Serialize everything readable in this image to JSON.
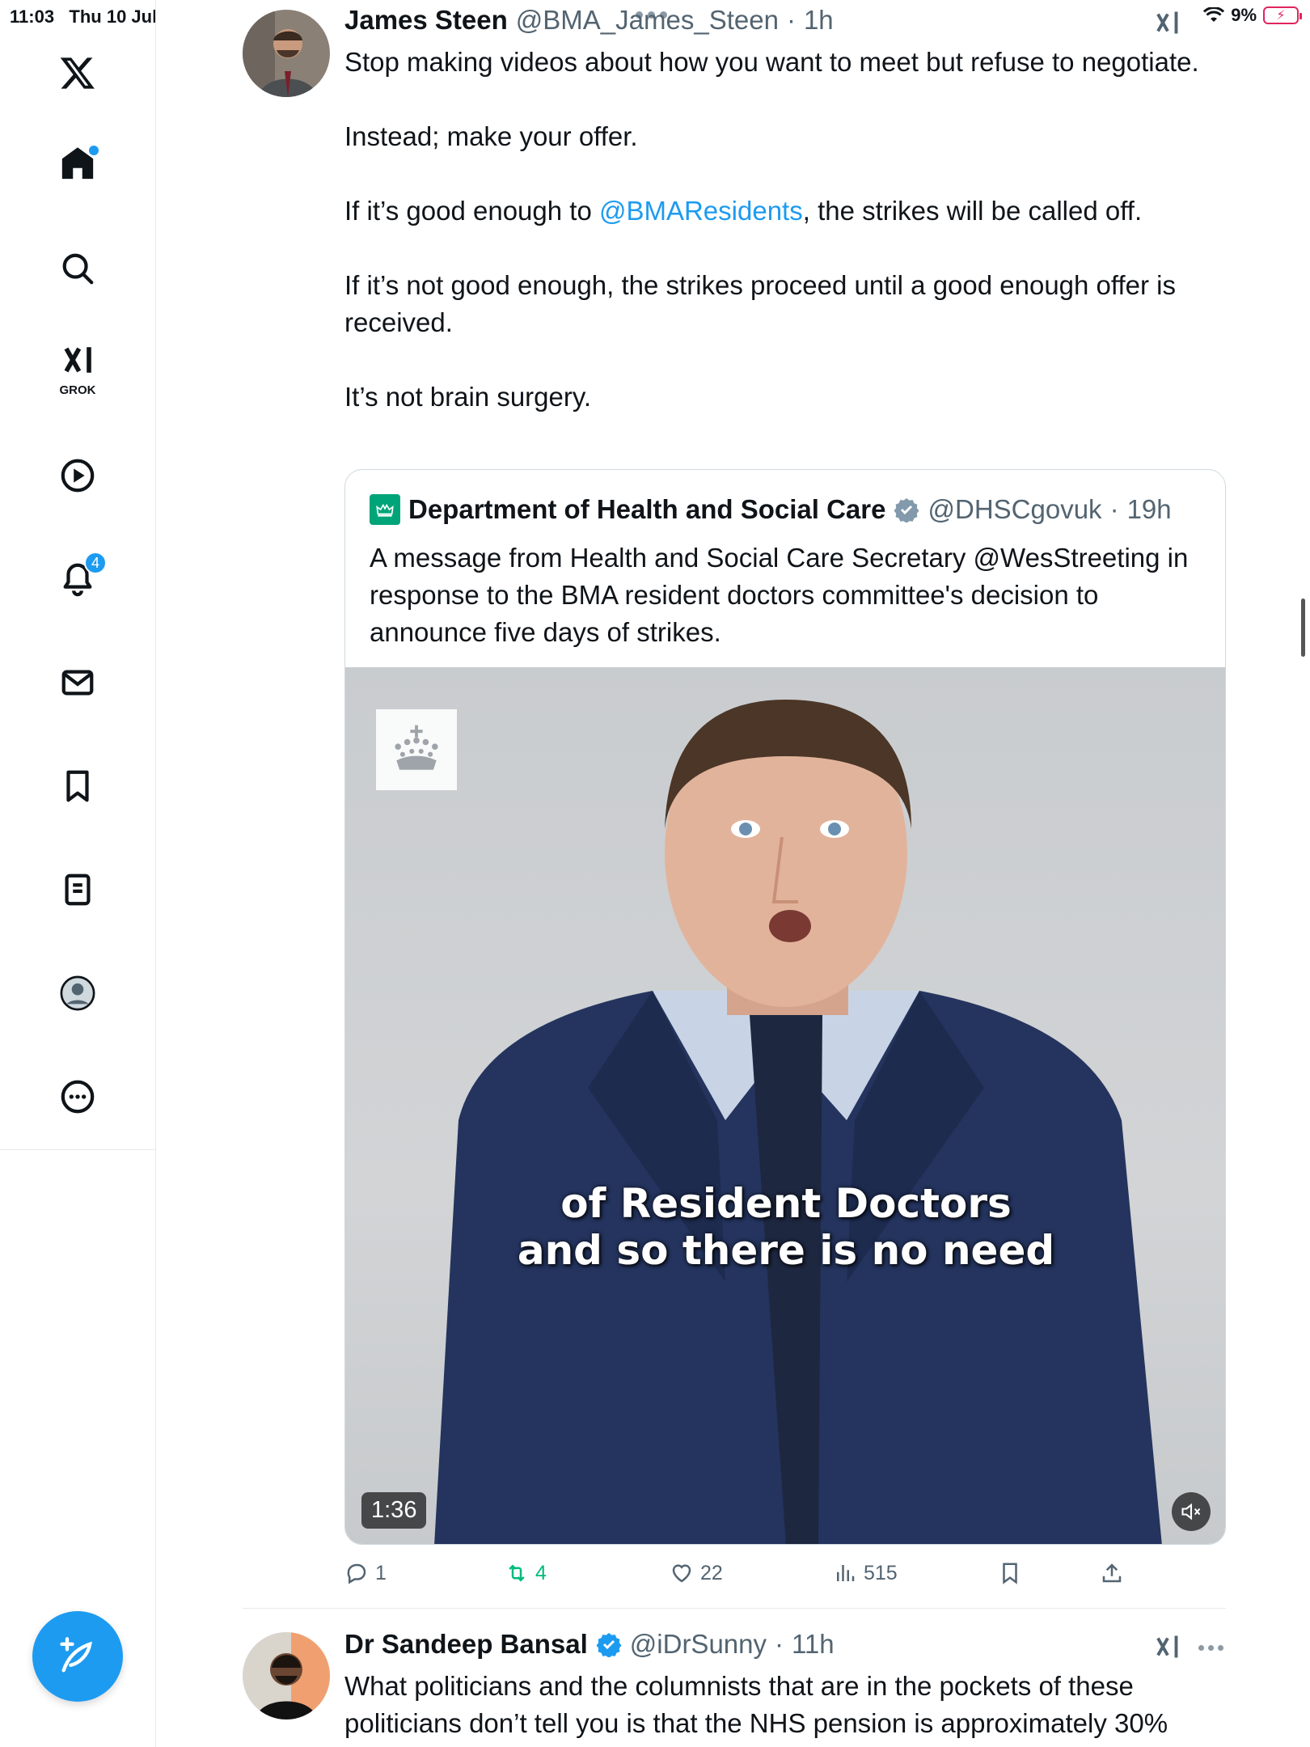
{
  "status": {
    "time": "11:03",
    "date": "Thu 10 Jul",
    "battery": "9%"
  },
  "sidebar": {
    "items": [
      {
        "name": "x-logo"
      },
      {
        "name": "home",
        "badge": ""
      },
      {
        "name": "search"
      },
      {
        "name": "grok",
        "label": "GROK"
      },
      {
        "name": "video"
      },
      {
        "name": "notifications",
        "badge": "4"
      },
      {
        "name": "messages"
      },
      {
        "name": "bookmarks"
      },
      {
        "name": "lists"
      },
      {
        "name": "profile"
      },
      {
        "name": "more"
      }
    ]
  },
  "tweet1": {
    "name": "James Steen",
    "handle": "@BMA_James_Steen",
    "time": "1h",
    "text": {
      "p1": "Stop making videos about how you want to meet but refuse to negotiate.",
      "p2": "Instead; make your offer.",
      "p3_before": "If it’s good enough to ",
      "p3_link": "@BMAResidents",
      "p3_after": ", the strikes will be called off.",
      "p4": "If it’s not good enough, the strikes proceed until a good enough offer is received.",
      "p5": "It’s not brain surgery."
    },
    "quote": {
      "name": "Department of Health and Social Care",
      "handle": "@DHSCgovuk",
      "time": "19h",
      "text": "A message from Health and Social Care Secretary @WesStreeting in response to the BMA resident doctors committee's decision to announce five days of strikes.",
      "video": {
        "caption_line1": "of Resident Doctors",
        "caption_line2": "and so there is no need",
        "duration": "1:36"
      }
    },
    "actions": {
      "replies": "1",
      "reposts": "4",
      "likes": "22",
      "views": "515"
    }
  },
  "tweet2": {
    "name": "Dr Sandeep Bansal",
    "handle": "@iDrSunny",
    "time": "11h",
    "text": "What politicians and the columnists that are in the pockets of these politicians don’t tell you is that the NHS pension is approximately 30%"
  },
  "colors": {
    "accent": "#1d9bf0",
    "repost_green": "#00ba7c",
    "muted": "#536471",
    "gov_green": "#00a479"
  }
}
